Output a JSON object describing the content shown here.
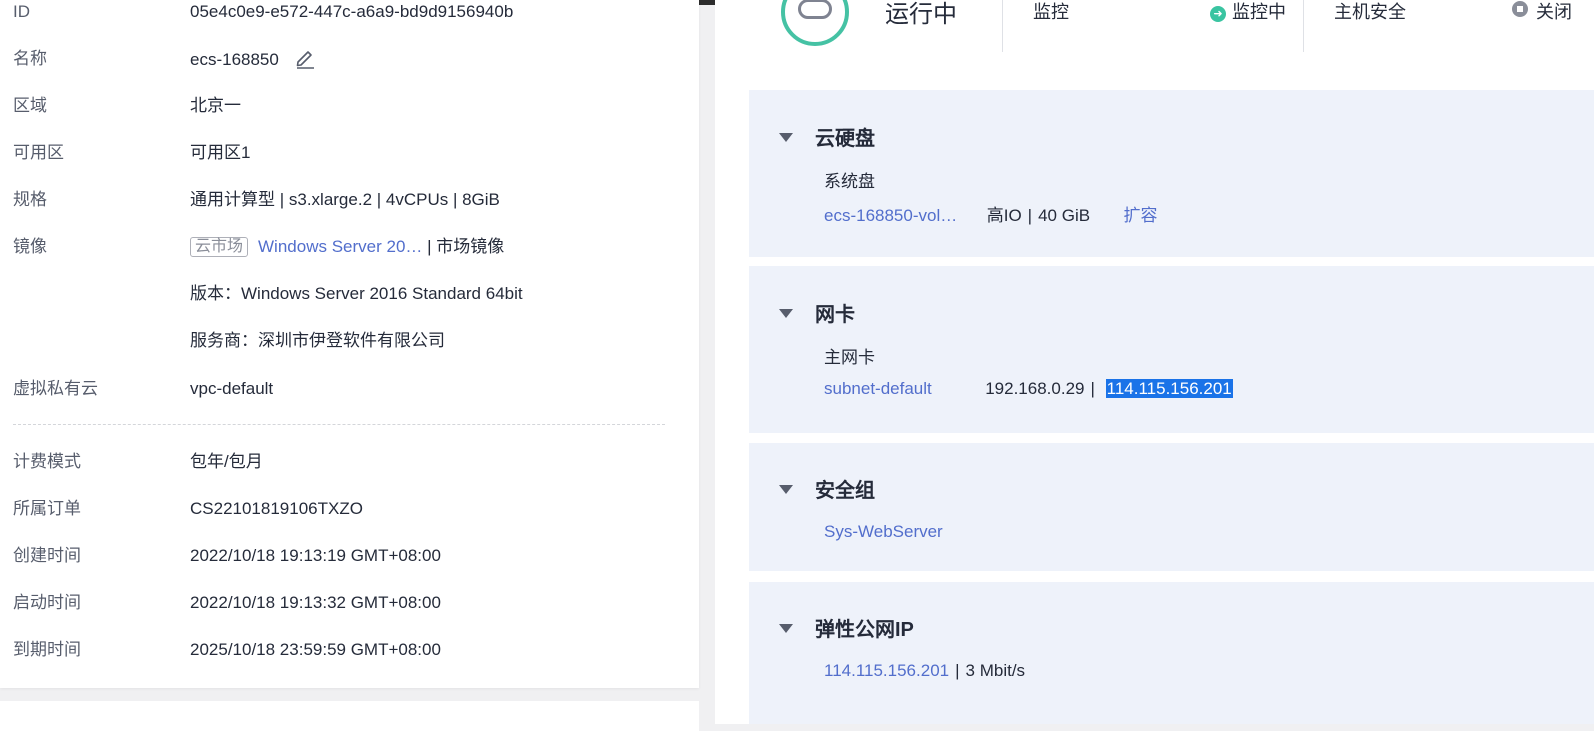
{
  "details": {
    "id_label": "ID",
    "id_value": "05e4c0e9-e572-447c-a6a9-bd9d9156940b",
    "name_label": "名称",
    "name_value": "ecs-168850",
    "region_label": "区域",
    "region_value": "北京一",
    "az_label": "可用区",
    "az_value": "可用区1",
    "spec_label": "规格",
    "spec_value": "通用计算型 | s3.xlarge.2 | 4vCPUs | 8GiB",
    "image_label": "镜像",
    "image_tag": "云市场",
    "image_link": "Windows Server 20…",
    "image_suffix": "| 市场镜像",
    "version_text": "版本：Windows Server 2016 Standard 64bit",
    "provider_text": "服务商：深圳市伊登软件有限公司",
    "vpc_label": "虚拟私有云",
    "vpc_value": "vpc-default",
    "billing_label": "计费模式",
    "billing_value": "包年/包月",
    "order_label": "所属订单",
    "order_value": "CS22101819106TXZO",
    "created_label": "创建时间",
    "created_value": "2022/10/18 19:13:19 GMT+08:00",
    "started_label": "启动时间",
    "started_value": "2022/10/18 19:13:32 GMT+08:00",
    "expire_label": "到期时间",
    "expire_value": "2025/10/18 23:59:59 GMT+08:00"
  },
  "status": {
    "state": "运行中",
    "monitor_label": "监控",
    "monitor_state": "监控中",
    "host_security_label": "主机安全",
    "host_security_state": "关闭"
  },
  "disk": {
    "title": "云硬盘",
    "sub": "系统盘",
    "volume_link": "ecs-168850-vol…",
    "type": "高IO",
    "size": "40 GiB",
    "expand_link": "扩容"
  },
  "nic": {
    "title": "网卡",
    "sub": "主网卡",
    "subnet_link": "subnet-default",
    "private_ip": "192.168.0.29",
    "public_ip": "114.115.156.201"
  },
  "secgroup": {
    "title": "安全组",
    "link": "Sys-WebServer"
  },
  "eip": {
    "title": "弹性公网IP",
    "ip_link": "114.115.156.201",
    "bandwidth": "3 Mbit/s"
  },
  "colors": {
    "link": "#526ecc",
    "running_ring": "#45c2a4",
    "card_bg": "#eef2fa",
    "selection": "#1a73e8"
  }
}
